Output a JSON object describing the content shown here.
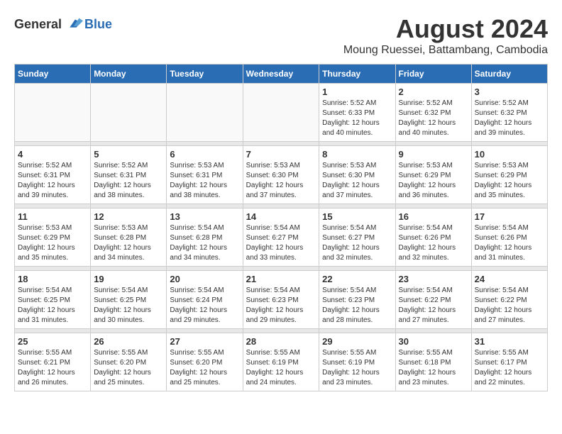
{
  "logo": {
    "text_general": "General",
    "text_blue": "Blue"
  },
  "title": {
    "month_year": "August 2024",
    "location": "Moung Ruessei, Battambang, Cambodia"
  },
  "days_of_week": [
    "Sunday",
    "Monday",
    "Tuesday",
    "Wednesday",
    "Thursday",
    "Friday",
    "Saturday"
  ],
  "weeks": [
    [
      {
        "day": "",
        "detail": ""
      },
      {
        "day": "",
        "detail": ""
      },
      {
        "day": "",
        "detail": ""
      },
      {
        "day": "",
        "detail": ""
      },
      {
        "day": "1",
        "detail": "Sunrise: 5:52 AM\nSunset: 6:33 PM\nDaylight: 12 hours\nand 40 minutes."
      },
      {
        "day": "2",
        "detail": "Sunrise: 5:52 AM\nSunset: 6:32 PM\nDaylight: 12 hours\nand 40 minutes."
      },
      {
        "day": "3",
        "detail": "Sunrise: 5:52 AM\nSunset: 6:32 PM\nDaylight: 12 hours\nand 39 minutes."
      }
    ],
    [
      {
        "day": "4",
        "detail": "Sunrise: 5:52 AM\nSunset: 6:31 PM\nDaylight: 12 hours\nand 39 minutes."
      },
      {
        "day": "5",
        "detail": "Sunrise: 5:52 AM\nSunset: 6:31 PM\nDaylight: 12 hours\nand 38 minutes."
      },
      {
        "day": "6",
        "detail": "Sunrise: 5:53 AM\nSunset: 6:31 PM\nDaylight: 12 hours\nand 38 minutes."
      },
      {
        "day": "7",
        "detail": "Sunrise: 5:53 AM\nSunset: 6:30 PM\nDaylight: 12 hours\nand 37 minutes."
      },
      {
        "day": "8",
        "detail": "Sunrise: 5:53 AM\nSunset: 6:30 PM\nDaylight: 12 hours\nand 37 minutes."
      },
      {
        "day": "9",
        "detail": "Sunrise: 5:53 AM\nSunset: 6:29 PM\nDaylight: 12 hours\nand 36 minutes."
      },
      {
        "day": "10",
        "detail": "Sunrise: 5:53 AM\nSunset: 6:29 PM\nDaylight: 12 hours\nand 35 minutes."
      }
    ],
    [
      {
        "day": "11",
        "detail": "Sunrise: 5:53 AM\nSunset: 6:29 PM\nDaylight: 12 hours\nand 35 minutes."
      },
      {
        "day": "12",
        "detail": "Sunrise: 5:53 AM\nSunset: 6:28 PM\nDaylight: 12 hours\nand 34 minutes."
      },
      {
        "day": "13",
        "detail": "Sunrise: 5:54 AM\nSunset: 6:28 PM\nDaylight: 12 hours\nand 34 minutes."
      },
      {
        "day": "14",
        "detail": "Sunrise: 5:54 AM\nSunset: 6:27 PM\nDaylight: 12 hours\nand 33 minutes."
      },
      {
        "day": "15",
        "detail": "Sunrise: 5:54 AM\nSunset: 6:27 PM\nDaylight: 12 hours\nand 32 minutes."
      },
      {
        "day": "16",
        "detail": "Sunrise: 5:54 AM\nSunset: 6:26 PM\nDaylight: 12 hours\nand 32 minutes."
      },
      {
        "day": "17",
        "detail": "Sunrise: 5:54 AM\nSunset: 6:26 PM\nDaylight: 12 hours\nand 31 minutes."
      }
    ],
    [
      {
        "day": "18",
        "detail": "Sunrise: 5:54 AM\nSunset: 6:25 PM\nDaylight: 12 hours\nand 31 minutes."
      },
      {
        "day": "19",
        "detail": "Sunrise: 5:54 AM\nSunset: 6:25 PM\nDaylight: 12 hours\nand 30 minutes."
      },
      {
        "day": "20",
        "detail": "Sunrise: 5:54 AM\nSunset: 6:24 PM\nDaylight: 12 hours\nand 29 minutes."
      },
      {
        "day": "21",
        "detail": "Sunrise: 5:54 AM\nSunset: 6:23 PM\nDaylight: 12 hours\nand 29 minutes."
      },
      {
        "day": "22",
        "detail": "Sunrise: 5:54 AM\nSunset: 6:23 PM\nDaylight: 12 hours\nand 28 minutes."
      },
      {
        "day": "23",
        "detail": "Sunrise: 5:54 AM\nSunset: 6:22 PM\nDaylight: 12 hours\nand 27 minutes."
      },
      {
        "day": "24",
        "detail": "Sunrise: 5:54 AM\nSunset: 6:22 PM\nDaylight: 12 hours\nand 27 minutes."
      }
    ],
    [
      {
        "day": "25",
        "detail": "Sunrise: 5:55 AM\nSunset: 6:21 PM\nDaylight: 12 hours\nand 26 minutes."
      },
      {
        "day": "26",
        "detail": "Sunrise: 5:55 AM\nSunset: 6:20 PM\nDaylight: 12 hours\nand 25 minutes."
      },
      {
        "day": "27",
        "detail": "Sunrise: 5:55 AM\nSunset: 6:20 PM\nDaylight: 12 hours\nand 25 minutes."
      },
      {
        "day": "28",
        "detail": "Sunrise: 5:55 AM\nSunset: 6:19 PM\nDaylight: 12 hours\nand 24 minutes."
      },
      {
        "day": "29",
        "detail": "Sunrise: 5:55 AM\nSunset: 6:19 PM\nDaylight: 12 hours\nand 23 minutes."
      },
      {
        "day": "30",
        "detail": "Sunrise: 5:55 AM\nSunset: 6:18 PM\nDaylight: 12 hours\nand 23 minutes."
      },
      {
        "day": "31",
        "detail": "Sunrise: 5:55 AM\nSunset: 6:17 PM\nDaylight: 12 hours\nand 22 minutes."
      }
    ]
  ]
}
